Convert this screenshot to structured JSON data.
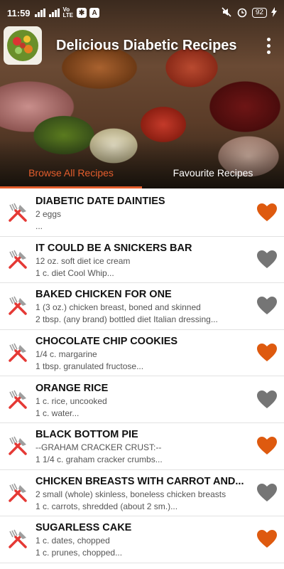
{
  "status_bar": {
    "time": "11:59",
    "network": "VoLTE",
    "battery": "92"
  },
  "app_bar": {
    "title": "Delicious Diabetic Recipes"
  },
  "tabs": [
    {
      "label": "Browse All Recipes",
      "active": true
    },
    {
      "label": "Favourite Recipes",
      "active": false
    }
  ],
  "colors": {
    "accent": "#e35d2d",
    "favorite": "#de5a0f",
    "not_favorite": "#757575"
  },
  "recipes": [
    {
      "title": "DIABETIC DATE DAINTIES",
      "line1": "2 eggs",
      "line2": "...",
      "favorite": true
    },
    {
      "title": "IT COULD BE A SNICKERS BAR",
      "line1": "12 oz. soft diet ice cream",
      "line2": "1 c. diet Cool Whip...",
      "favorite": false
    },
    {
      "title": "BAKED CHICKEN FOR ONE",
      "line1": "1 (3 oz.) chicken breast, boned and skinned",
      "line2": "2 tbsp. (any brand) bottled diet Italian dressing...",
      "favorite": false
    },
    {
      "title": "CHOCOLATE CHIP COOKIES",
      "line1": "1/4 c. margarine",
      "line2": "1 tbsp. granulated fructose...",
      "favorite": true
    },
    {
      "title": "ORANGE RICE",
      "line1": "1 c. rice, uncooked",
      "line2": "1 c. water...",
      "favorite": false
    },
    {
      "title": "BLACK BOTTOM PIE",
      "line1": "--GRAHAM CRACKER CRUST:--",
      "line2": "1 1/4 c. graham cracker crumbs...",
      "favorite": true
    },
    {
      "title": "CHICKEN BREASTS WITH CARROT AND...",
      "line1": "2 small (whole) skinless, boneless chicken breasts",
      "line2": "1 c. carrots, shredded (about 2 sm.)...",
      "favorite": false
    },
    {
      "title": "SUGARLESS CAKE",
      "line1": "1 c. dates, chopped",
      "line2": "1 c. prunes, chopped...",
      "favorite": true
    }
  ]
}
